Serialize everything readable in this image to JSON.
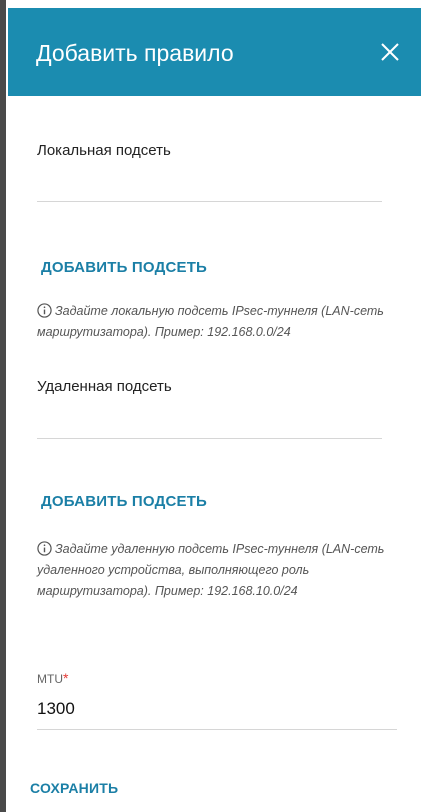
{
  "dialog": {
    "title": "Добавить правило",
    "close_icon": "close-icon"
  },
  "local_subnet": {
    "label": "Локальная подсеть",
    "value": "",
    "add_label": "ДОБАВИТЬ ПОДСЕТЬ",
    "hint": "Задайте локальную подсеть IPsec-туннеля (LAN-сеть маршрутизатора). Пример: 192.168.0.0/24"
  },
  "remote_subnet": {
    "label": "Удаленная подсеть",
    "value": "",
    "add_label": "ДОБАВИТЬ ПОДСЕТЬ",
    "hint": "Задайте удаленную подсеть IPsec-туннеля (LAN-сеть удаленного устройства, выполняющего роль маршрутизатора). Пример: 192.168.10.0/24"
  },
  "mtu": {
    "label": "MTU",
    "required_mark": "*",
    "value": "1300"
  },
  "actions": {
    "save_label": "СОХРАНИТЬ"
  },
  "colors": {
    "header_bg": "#1b8cb0",
    "link": "#1b7fa6",
    "required": "#e53935"
  },
  "icons": {
    "info": "info-icon",
    "close": "close-icon"
  }
}
